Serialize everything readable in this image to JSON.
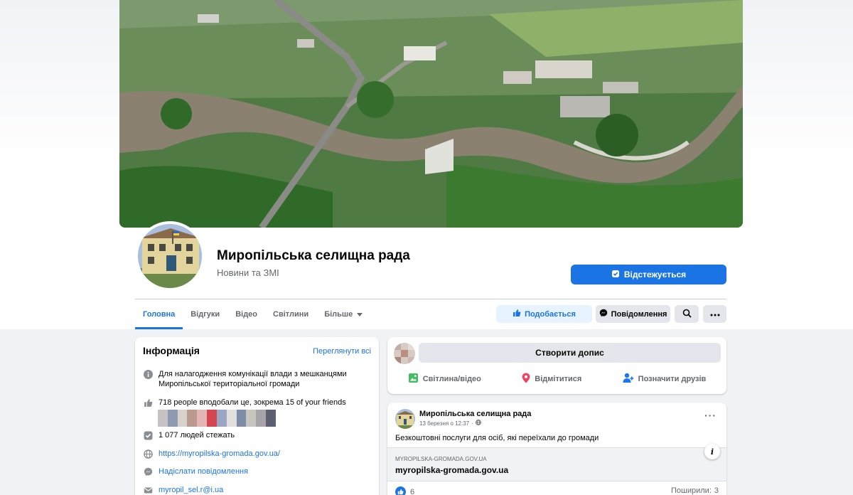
{
  "page": {
    "title": "Миропільська селищна рада",
    "category": "Новини та ЗМІ",
    "follow_label": "Відстежується"
  },
  "tabs": [
    {
      "label": "Головна"
    },
    {
      "label": "Відгуки"
    },
    {
      "label": "Відео"
    },
    {
      "label": "Світлини"
    },
    {
      "label": "Більше"
    }
  ],
  "actions": {
    "like_label": "Подобається",
    "message_label": "Повідомлення"
  },
  "info": {
    "title": "Інформація",
    "see_all": "Переглянути всі",
    "about": "Для налагодження комунікації влади з мешканцями Миропільської територіальної громади",
    "likes": "718 people вподобали це, зокрема 15 of your friends",
    "followers": "1 077 людей стежать",
    "website": "https://myropilska-gromada.gov.ua/",
    "send_message": "Надіслати повідомлення",
    "email": "myropil_sel.r@i.ua"
  },
  "composer": {
    "placeholder": "Створити допис",
    "photo_label": "Світлина/відео",
    "checkin_label": "Відмітитися",
    "tag_label": "Позначити друзів"
  },
  "post": {
    "author": "Миропільська селищна рада",
    "date": "13 березня о 12:37",
    "text": "Безкоштовні послуги для осіб, які переїхали до громади",
    "link_domain": "MYROPILSKA-GROMADA.GOV.UA",
    "link_title": "myropilska-gromada.gov.ua",
    "reactions_count": "6",
    "shares_label": "Поширили:",
    "shares_count": "3"
  },
  "icons": {
    "info": "info-icon",
    "like": "thumbs-up-icon",
    "followers": "follow-check-icon",
    "globe": "globe-icon",
    "messenger": "messenger-icon",
    "email": "envelope-icon",
    "search": "search-icon",
    "more": "more-icon",
    "photo": "photo-icon",
    "checkin": "location-pin-icon",
    "tag": "tag-friends-icon",
    "public": "globe-small-icon"
  },
  "colors": {
    "accent": "#1b74e4",
    "accent_soft": "#e7f3ff",
    "button_gray": "#e4e6eb",
    "background": "#f0f2f5",
    "photo_green": "#45bd62",
    "checkin_red": "#f3425f"
  }
}
